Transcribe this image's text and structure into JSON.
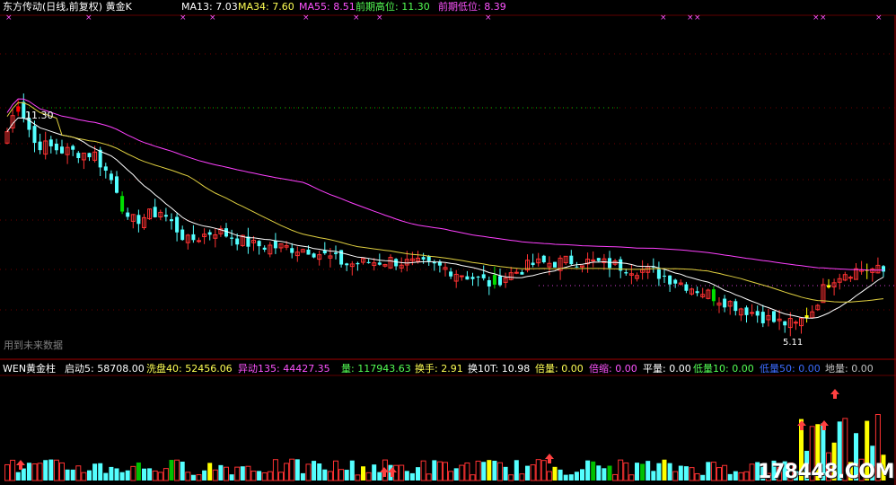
{
  "header": {
    "title": "东方传动(日线,前复权) 黄金K",
    "items": [
      {
        "label": "MA13: 7.03",
        "color": "#ffffff"
      },
      {
        "label": "MA34: 7.60",
        "color": "#ffff54"
      },
      {
        "label": "MA55: 8.51",
        "color": "#ff54ff"
      },
      {
        "label": "前期高位: 11.30",
        "color": "#54ff54"
      },
      {
        "label": "前期低位: 8.39",
        "color": "#ff54ff"
      }
    ]
  },
  "main": {
    "high_label": "11.30",
    "low_label": "5.11",
    "future_label": "用到未来数据"
  },
  "indicator": {
    "title": "WEN黄金柱",
    "items": [
      {
        "label": "启动5: 58708.00",
        "color": "#ffffff"
      },
      {
        "label": "洗盘40: 52456.06",
        "color": "#ffff54"
      },
      {
        "label": "异动135: 44427.35",
        "color": "#ff54ff"
      },
      {
        "label": "量: 117943.63",
        "color": "#54ff54"
      },
      {
        "label": "换手: 2.91",
        "color": "#ffff54"
      },
      {
        "label": "换10T: 10.98",
        "color": "#ffffff"
      },
      {
        "label": "倍量: 0.00",
        "color": "#ffff54"
      },
      {
        "label": "倍缩: 0.00",
        "color": "#ff54ff"
      },
      {
        "label": "平量: 0.00",
        "color": "#ffffff"
      },
      {
        "label": "低量10: 0.00",
        "color": "#54ff54"
      },
      {
        "label": "低量50: 0.00",
        "color": "#3c6cff"
      },
      {
        "label": "地量: 0.00",
        "color": "#c0c0c0"
      }
    ]
  },
  "watermark": "178448.COM",
  "chart_data": {
    "type": "candlestick",
    "x": [
      0,
      1,
      2,
      3,
      4,
      5,
      6,
      7,
      8,
      9,
      10,
      11,
      12,
      13,
      14,
      15,
      16,
      17,
      18,
      19,
      20,
      21,
      22,
      23,
      24,
      25,
      26,
      27,
      28,
      29,
      30,
      31,
      32,
      33,
      34,
      35,
      36,
      37,
      38,
      39,
      40,
      41,
      42,
      43,
      44,
      45,
      46,
      47,
      48,
      49,
      50,
      51,
      52,
      53,
      54,
      55,
      56,
      57,
      58,
      59,
      60,
      61,
      62,
      63,
      64,
      65,
      66,
      67,
      68,
      69,
      70,
      71,
      72,
      73,
      74,
      75,
      76,
      77,
      78,
      79,
      80,
      81,
      82,
      83,
      84,
      85,
      86,
      87,
      88,
      89,
      90,
      91,
      92,
      93,
      94,
      95,
      96,
      97,
      98,
      99,
      100,
      101,
      102,
      103,
      104,
      105,
      106,
      107,
      108,
      109,
      110,
      111,
      112,
      113,
      114,
      115,
      116,
      117,
      118,
      119,
      120,
      121,
      122,
      123,
      124,
      125,
      126,
      127,
      128,
      129,
      130,
      131,
      132,
      133,
      134,
      135,
      136,
      137,
      138,
      139,
      140,
      141,
      142,
      143,
      144,
      145,
      146,
      147,
      148,
      149,
      150,
      151,
      152,
      153,
      154,
      155,
      156,
      157,
      158,
      159,
      160
    ],
    "price_range": [
      4.3,
      12.3
    ],
    "high": 11.3,
    "low": 5.11
  }
}
